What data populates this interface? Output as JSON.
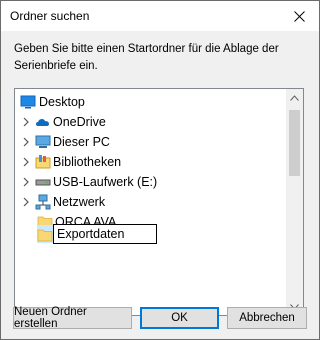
{
  "window": {
    "title": "Ordner suchen",
    "close_label": "✕"
  },
  "dialog": {
    "instruction": "Geben Sie bitte einen Startordner für die Ablage der Serienbriefe ein."
  },
  "tree": {
    "items": [
      {
        "label": "Desktop",
        "icon": "desktop-icon",
        "expander": "none"
      },
      {
        "label": "OneDrive",
        "icon": "onedrive-icon",
        "expander": "collapsed"
      },
      {
        "label": "Dieser PC",
        "icon": "computer-icon",
        "expander": "collapsed"
      },
      {
        "label": "Bibliotheken",
        "icon": "library-icon",
        "expander": "collapsed"
      },
      {
        "label": "USB-Laufwerk (E:)",
        "icon": "drive-icon",
        "expander": "collapsed"
      },
      {
        "label": "Netzwerk",
        "icon": "network-icon",
        "expander": "collapsed"
      },
      {
        "label": "ORCA AVA",
        "icon": "folder-icon",
        "expander": "none"
      },
      {
        "label": "",
        "icon": "folder-icon",
        "expander": "none"
      }
    ],
    "editing_value": "Exportdaten"
  },
  "buttons": {
    "new_folder": "Neuen Ordner erstellen",
    "ok": "OK",
    "cancel": "Abbrechen"
  },
  "colors": {
    "accent": "#0078d7",
    "folder": "#f8d775",
    "selection": "#cce8ff"
  }
}
